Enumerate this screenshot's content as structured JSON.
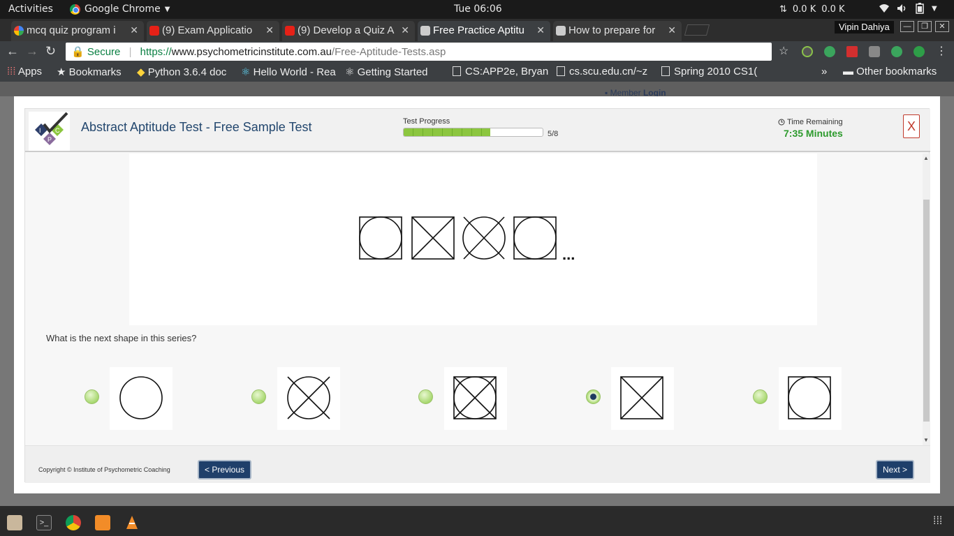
{
  "system_bar": {
    "activities": "Activities",
    "app_name": "Google Chrome",
    "clock": "Tue 06:06",
    "net_up": "0.0 K",
    "net_down": "0.0 K"
  },
  "tabs": [
    {
      "label": "mcq quiz program i",
      "icon": "google-icon"
    },
    {
      "label": "(9) Exam Applicatio",
      "icon": "youtube-icon"
    },
    {
      "label": "(9) Develop a Quiz A",
      "icon": "youtube-icon"
    },
    {
      "label": "Free Practice Aptitu",
      "icon": "ipc-favicon",
      "active": true
    },
    {
      "label": "How to prepare for",
      "icon": "ipc-favicon"
    }
  ],
  "user_name": "Vipin Dahiya",
  "omnibox": {
    "secure_label": "Secure",
    "scheme": "https://",
    "host": "www.psychometricinstitute.com.au",
    "path": "/Free-Aptitude-Tests.asp"
  },
  "bookmarks": {
    "apps": "Apps",
    "items": [
      "Bookmarks",
      "Python 3.6.4 doc",
      "Hello World - Rea",
      "Getting Started",
      "CS:APP2e, Bryan",
      "cs.scu.edu.cn/~z",
      "Spring 2010 CS1("
    ],
    "overflow": "»",
    "other": "Other bookmarks"
  },
  "page_bg": {
    "member": "Member",
    "login": "Login"
  },
  "modal": {
    "title": "Abstract Aptitude Test - Free Sample Test",
    "progress_label": "Test Progress",
    "progress_value": 0.625,
    "progress_text": "5/8",
    "time_label": "Time Remaining",
    "time_value": "7:35 Minutes",
    "close_label": "X",
    "question": "What is the next shape in this series?",
    "series_ellipsis": "...",
    "series": [
      "square-circle",
      "square-x",
      "circle-x",
      "square-circle"
    ],
    "options": [
      {
        "shape": "circle",
        "selected": false
      },
      {
        "shape": "circle-x",
        "selected": false
      },
      {
        "shape": "square-circle-x",
        "selected": false
      },
      {
        "shape": "square-x",
        "selected": true
      },
      {
        "shape": "square-circle",
        "selected": false
      }
    ],
    "copyright": "Copyright © Institute of Psychometric Coaching",
    "prev_label": "< Previous",
    "next_label": "Next >"
  },
  "colors": {
    "title_blue": "#23476e",
    "progress_green": "#8cc63f",
    "time_green": "#2c9a2c",
    "close_red": "#c0392b",
    "button_navy": "#1f3f6a"
  }
}
